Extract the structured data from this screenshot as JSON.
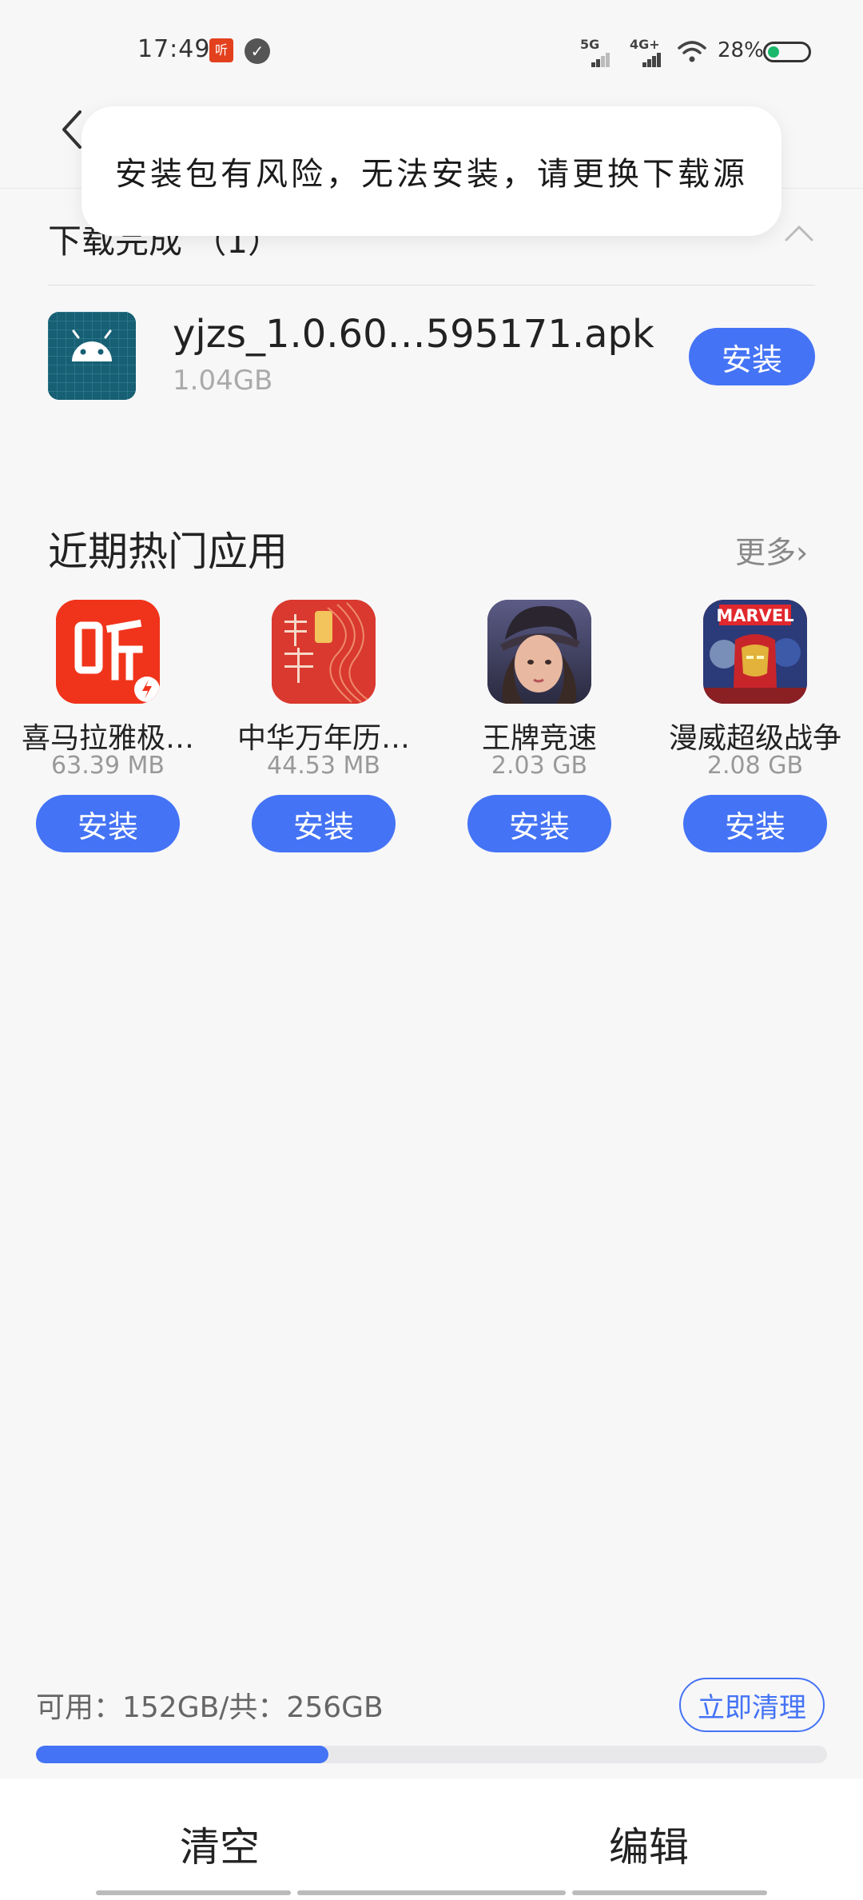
{
  "status_bar": {
    "time": "17:49",
    "notification_app_icon": "ximalaya-icon",
    "notification_check_icon": "check-icon",
    "signal_1_label": "5G",
    "signal_2_label": "4G+",
    "battery": "28%"
  },
  "toast": {
    "message": "安装包有风险，无法安装，请更换下载源"
  },
  "downloads": {
    "section_title": "下载完成 （1）",
    "items": [
      {
        "name": "yjzs_1.0.60…595171.apk",
        "size": "1.04GB",
        "install_label": "安装",
        "icon": "android-icon"
      }
    ]
  },
  "hot_apps": {
    "title": "近期热门应用",
    "more_label": "更多",
    "apps": [
      {
        "name": "喜马拉雅极…",
        "size": "63.39 MB",
        "install_label": "安装",
        "icon": "ximalaya-app-icon",
        "color": "#f0341b"
      },
      {
        "name": "中华万年历…",
        "size": "44.53 MB",
        "install_label": "安装",
        "icon": "calendar-app-icon",
        "color": "#d9392f"
      },
      {
        "name": "王牌竞速",
        "size": "2.03 GB",
        "install_label": "安装",
        "icon": "racing-game-icon",
        "color": "#3b3a5c"
      },
      {
        "name": "漫威超级战争",
        "size": "2.08 GB",
        "install_label": "安装",
        "icon": "marvel-game-icon",
        "color": "#c62026"
      }
    ]
  },
  "storage": {
    "text": "可用：152GB/共：256GB",
    "used_fraction": 0.37,
    "clean_label": "立即清理"
  },
  "bottom_bar": {
    "clear_label": "清空",
    "edit_label": "编辑"
  },
  "colors": {
    "accent": "#4473f5",
    "background": "#f7f7f8"
  }
}
